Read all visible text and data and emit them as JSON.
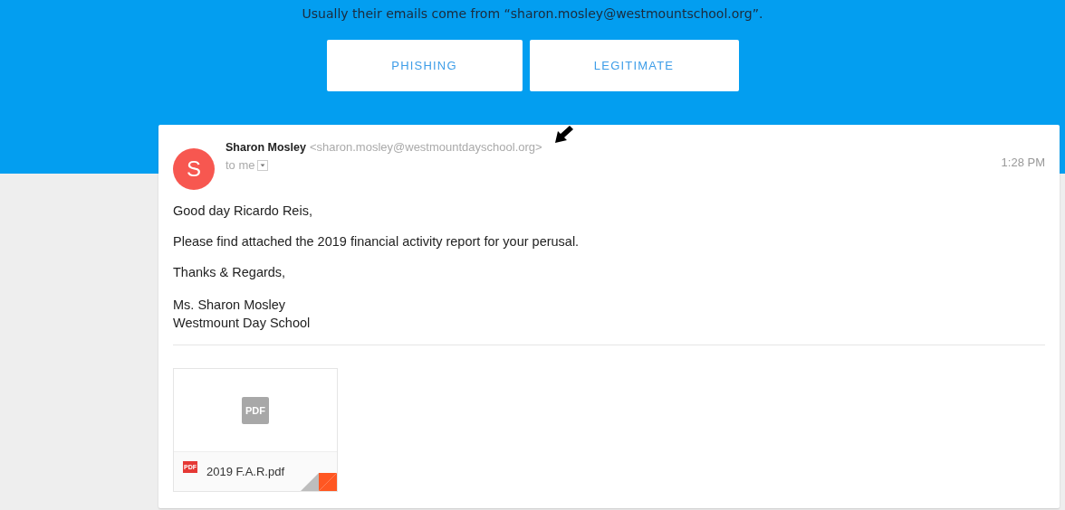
{
  "banner": {
    "hint": "Usually their emails come from “sharon.mosley@westmountschool.org”.",
    "buttons": [
      "PHISHING",
      "LEGITIMATE"
    ]
  },
  "email": {
    "avatar": "S",
    "sender_name": "Sharon Mosley",
    "sender_address": "<sharon.mosley@westmountdayschool.org>",
    "recipient": "to me",
    "time": "1:28 PM",
    "body": [
      "Good day Ricardo Reis,",
      "Please find attached the 2019 financial activity report for your perusal.",
      "Thanks & Regards,"
    ],
    "signature": [
      "Ms. Sharon Mosley",
      "Westmount Day School"
    ],
    "attachment": {
      "preview_label": "PDF",
      "type_label": "PDF",
      "filename": "2019 F.A.R.pdf"
    }
  }
}
